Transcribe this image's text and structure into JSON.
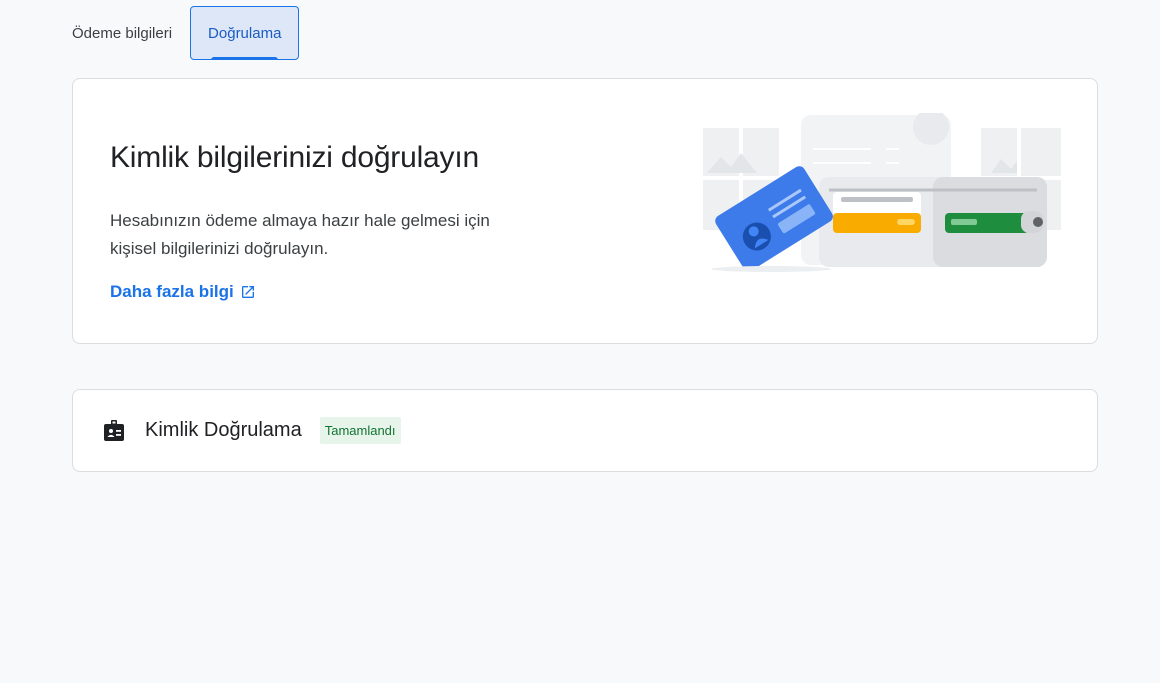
{
  "tabs": [
    {
      "label": "Ödeme bilgileri",
      "active": false
    },
    {
      "label": "Doğrulama",
      "active": true
    }
  ],
  "hero": {
    "title": "Kimlik bilgilerinizi doğrulayın",
    "description": "Hesabınızın ödeme almaya hazır hale gelmesi için kişisel bilgilerinizi doğrulayın.",
    "link_label": "Daha fazla bilgi",
    "link_icon": "open-in-new-icon",
    "illustration": "id-card-and-wallet-illustration"
  },
  "status": {
    "icon": "badge-id-icon",
    "label": "Kimlik Doğrulama",
    "badge": "Tamamlandı"
  },
  "colors": {
    "accent": "#1a73e8",
    "success_bg": "#e6f4ea",
    "success_text": "#137333",
    "page_bg": "#f8f9fa"
  }
}
